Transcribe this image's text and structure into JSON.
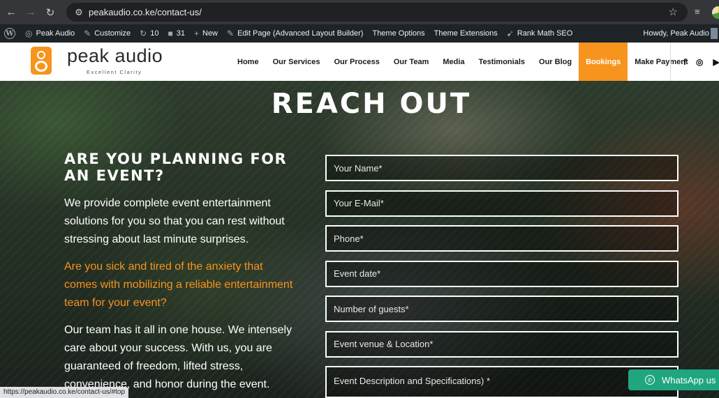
{
  "browser": {
    "url": "peakaudio.co.ke/contact-us/",
    "status_url": "https://peakaudio.co.ke/contact-us/#top",
    "icons": [
      "back-arrow",
      "forward-arrow",
      "reload",
      "tune",
      "star",
      "reading-list",
      "profile-avatar"
    ]
  },
  "adminbar": {
    "site": "Peak Audio",
    "customize": "Customize",
    "updates": "10",
    "comments": "31",
    "new": "New",
    "edit": "Edit Page (Advanced Layout Builder)",
    "theme_options": "Theme Options",
    "theme_extensions": "Theme Extensions",
    "rank_math": "Rank Math SEO",
    "howdy": "Howdy, Peak Audio"
  },
  "header": {
    "logo_name": "peak audio",
    "logo_tagline": "Excellent Clarity",
    "nav": [
      "Home",
      "Our Services",
      "Our Process",
      "Our Team",
      "Media",
      "Testimonials",
      "Our Blog",
      "Bookings",
      "Make Payment"
    ],
    "active_nav": "Bookings",
    "social": [
      "facebook",
      "instagram",
      "youtube"
    ]
  },
  "hero": {
    "title": "REACH OUT",
    "left_heading": "ARE YOU PLANNING FOR AN EVENT?",
    "para1": "We provide complete event entertainment solutions for you so that you can rest without stressing about last minute surprises.",
    "para2": "Are you sick and tired of the anxiety that comes with mobilizing a reliable entertainment team for your event?",
    "para3": "Our team has it all in one house. We intensely care about your success. With us, you are guaranteed of freedom, lifted stress, convenience, and honor during the event."
  },
  "form": {
    "name": "Your Name*",
    "email": "Your E-Mail*",
    "phone": "Phone*",
    "date": "Event date*",
    "guests": "Number of guests*",
    "venue": "Event venue & Location*",
    "description": "Event Description and Specifications) *"
  },
  "whatsapp": {
    "label": "WhatsApp us"
  },
  "colors": {
    "accent": "#f7941d",
    "whatsapp": "#1fa680",
    "adminbar": "#1d2327"
  }
}
